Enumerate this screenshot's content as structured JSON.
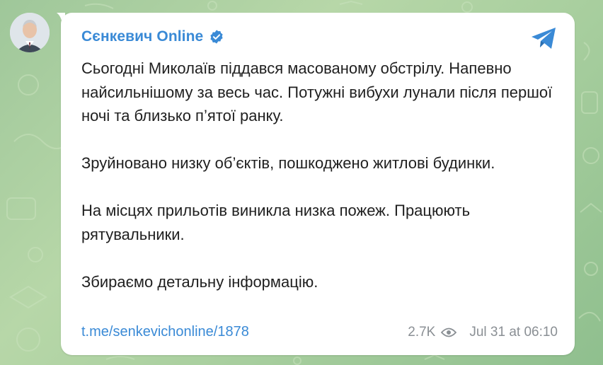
{
  "colors": {
    "background": "#a9cf9f",
    "bubble": "#ffffff",
    "accent": "#3a8ad6",
    "text": "#1f1f1f",
    "meta": "#8a8f94"
  },
  "post": {
    "channel_name": "Сєнкевич Online",
    "verified_icon": "verified-check-icon",
    "share_icon": "telegram-share-icon",
    "paragraphs": [
      "Сьогодні Миколаїв піддався масованому обстрілу. Напевно найсильнішому за весь час. Потужні вибухи лунали після першої ночі та близько п’ятої ранку.",
      "Зруйновано низку об’єктів, пошкоджено житлові будинки.",
      "На місцях прильотів виникла низка пожеж. Працюють рятувальники.",
      "Збираємо детальну інформацію."
    ],
    "link": "t.me/senkevichonline/1878",
    "views": "2.7K",
    "views_icon": "eye-icon",
    "date": "Jul 31 at 06:10"
  }
}
